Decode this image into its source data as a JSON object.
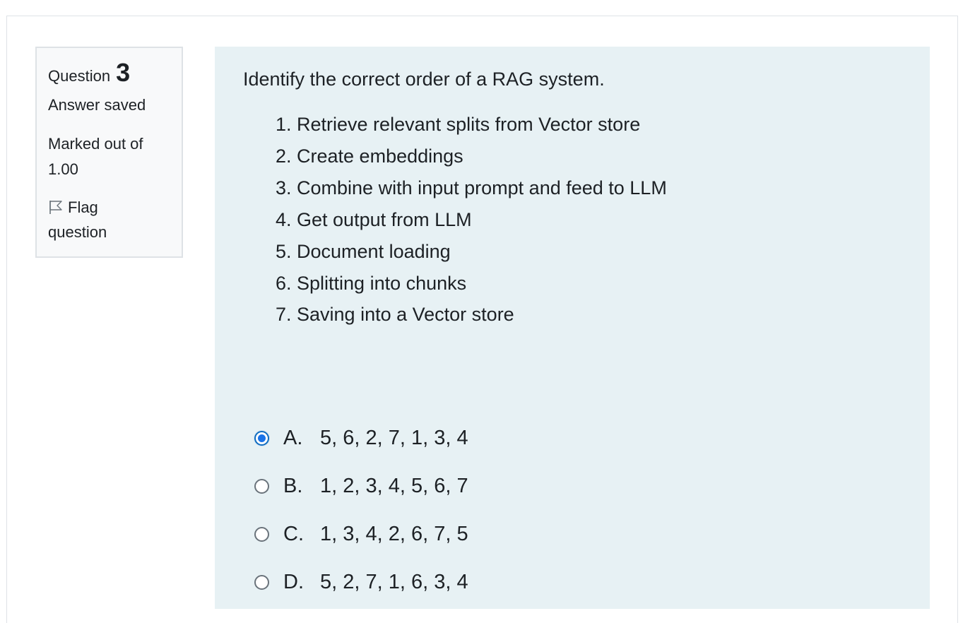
{
  "question_info": {
    "label": "Question",
    "number": "3",
    "state": "Answer saved",
    "grade_line1": "Marked out of",
    "grade_line2": "1.00",
    "flag_line1": "Flag",
    "flag_line2": "question",
    "flag_icon": "flag-outline-icon"
  },
  "question": {
    "text": "Identify the correct order of a RAG system.",
    "steps": [
      "1. Retrieve relevant splits from Vector store",
      "2. Create embeddings",
      "3. Combine with input prompt and feed to LLM",
      "4. Get output from LLM",
      "5. Document loading",
      "6. Splitting into chunks",
      "7. Saving into a Vector store"
    ]
  },
  "answers": [
    {
      "letter": "A.",
      "text": "5, 6, 2, 7, 1, 3, 4",
      "selected": true
    },
    {
      "letter": "B.",
      "text": "1, 2, 3, 4, 5, 6, 7",
      "selected": false
    },
    {
      "letter": "C.",
      "text": "1, 3, 4, 2, 6, 7, 5",
      "selected": false
    },
    {
      "letter": "D.",
      "text": "5, 2, 7, 1, 6, 3, 4",
      "selected": false
    }
  ],
  "colors": {
    "panel_bg": "#e7f1f4",
    "info_bg": "#f8f9fa",
    "radio_selected": "#1a73e8",
    "text": "#1d2125"
  }
}
